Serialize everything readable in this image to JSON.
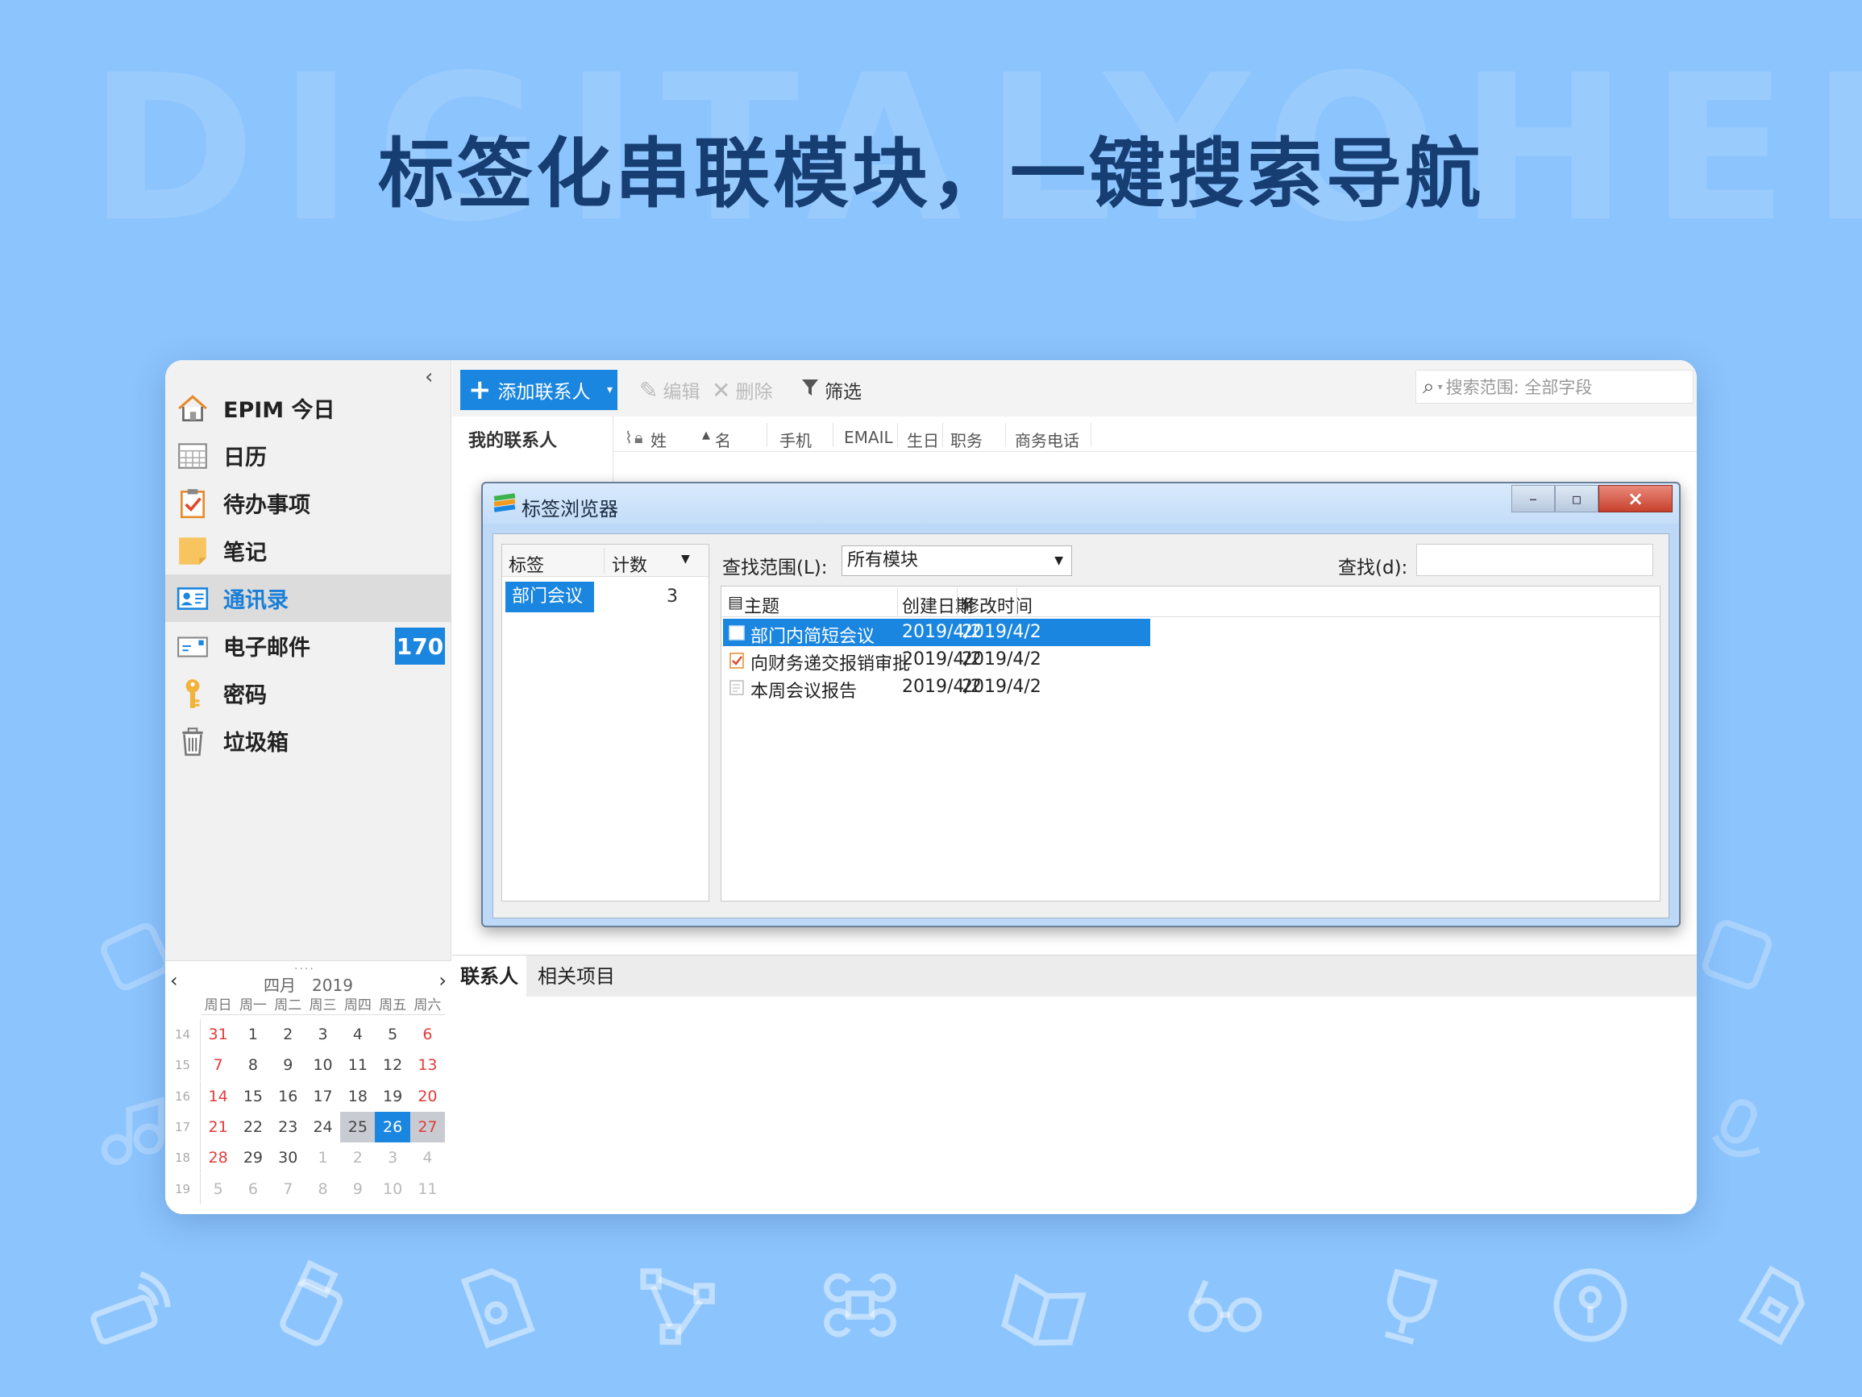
{
  "watermark": "DIGITALYOHEE",
  "headline": "标签化串联模块，一键搜索导航",
  "sidebar": {
    "collapse": "‹",
    "items": [
      {
        "label": "EPIM 今日",
        "icon": "home-icon"
      },
      {
        "label": "日历",
        "icon": "calendar-icon"
      },
      {
        "label": "待办事项",
        "icon": "todo-icon"
      },
      {
        "label": "笔记",
        "icon": "note-icon"
      },
      {
        "label": "通讯录",
        "icon": "contacts-icon"
      },
      {
        "label": "电子邮件",
        "icon": "email-icon",
        "badge": "170"
      },
      {
        "label": "密码",
        "icon": "key-icon"
      },
      {
        "label": "垃圾箱",
        "icon": "trash-icon"
      }
    ]
  },
  "calendar": {
    "grip": "····",
    "prev": "‹",
    "next": "›",
    "month": "四月",
    "year": "2019",
    "dows": [
      "周日",
      "周一",
      "周二",
      "周三",
      "周四",
      "周五",
      "周六"
    ],
    "weeks": [
      {
        "wk": "14",
        "days": [
          "31",
          "1",
          "2",
          "3",
          "4",
          "5",
          "6"
        ]
      },
      {
        "wk": "15",
        "days": [
          "7",
          "8",
          "9",
          "10",
          "11",
          "12",
          "13"
        ]
      },
      {
        "wk": "16",
        "days": [
          "14",
          "15",
          "16",
          "17",
          "18",
          "19",
          "20"
        ]
      },
      {
        "wk": "17",
        "days": [
          "21",
          "22",
          "23",
          "24",
          "25",
          "26",
          "27"
        ]
      },
      {
        "wk": "18",
        "days": [
          "28",
          "29",
          "30",
          "1",
          "2",
          "3",
          "4"
        ]
      },
      {
        "wk": "19",
        "days": [
          "5",
          "6",
          "7",
          "8",
          "9",
          "10",
          "11"
        ]
      }
    ]
  },
  "toolbar": {
    "add": "添加联系人",
    "edit": "编辑",
    "delete": "删除",
    "filter": "筛选",
    "search_placeholder": "搜索范围: 全部字段"
  },
  "contacts": {
    "pane_title": "我的联系人",
    "columns": [
      "姓",
      "名",
      "手机",
      "EMAIL",
      "生日",
      "职务",
      "商务电话"
    ]
  },
  "bottom_tabs": [
    "联系人",
    "相关项目"
  ],
  "dialog": {
    "title": "标签浏览器",
    "win_min": "–",
    "win_max": "▫",
    "win_close": "×",
    "tag_header": "标签",
    "count_header": "计数",
    "tags": [
      {
        "name": "部门会议",
        "count": "3"
      }
    ],
    "scope_label": "查找范围(L):",
    "scope_value": "所有模块",
    "find_label": "查找(d):",
    "result_headers": [
      "主题",
      "创建日期",
      "修改时间"
    ],
    "results": [
      {
        "subject": "部门内简短会议",
        "created": "2019/4/2",
        "modified": "2019/4/2"
      },
      {
        "subject": "向财务递交报销审批",
        "created": "2019/4/2",
        "modified": "2019/4/2"
      },
      {
        "subject": "本周会议报告",
        "created": "2019/4/2",
        "modified": "2019/4/2"
      }
    ]
  },
  "colors": {
    "accent": "#1a86e0",
    "background": "#8cc4fd",
    "headline": "#173e72"
  }
}
